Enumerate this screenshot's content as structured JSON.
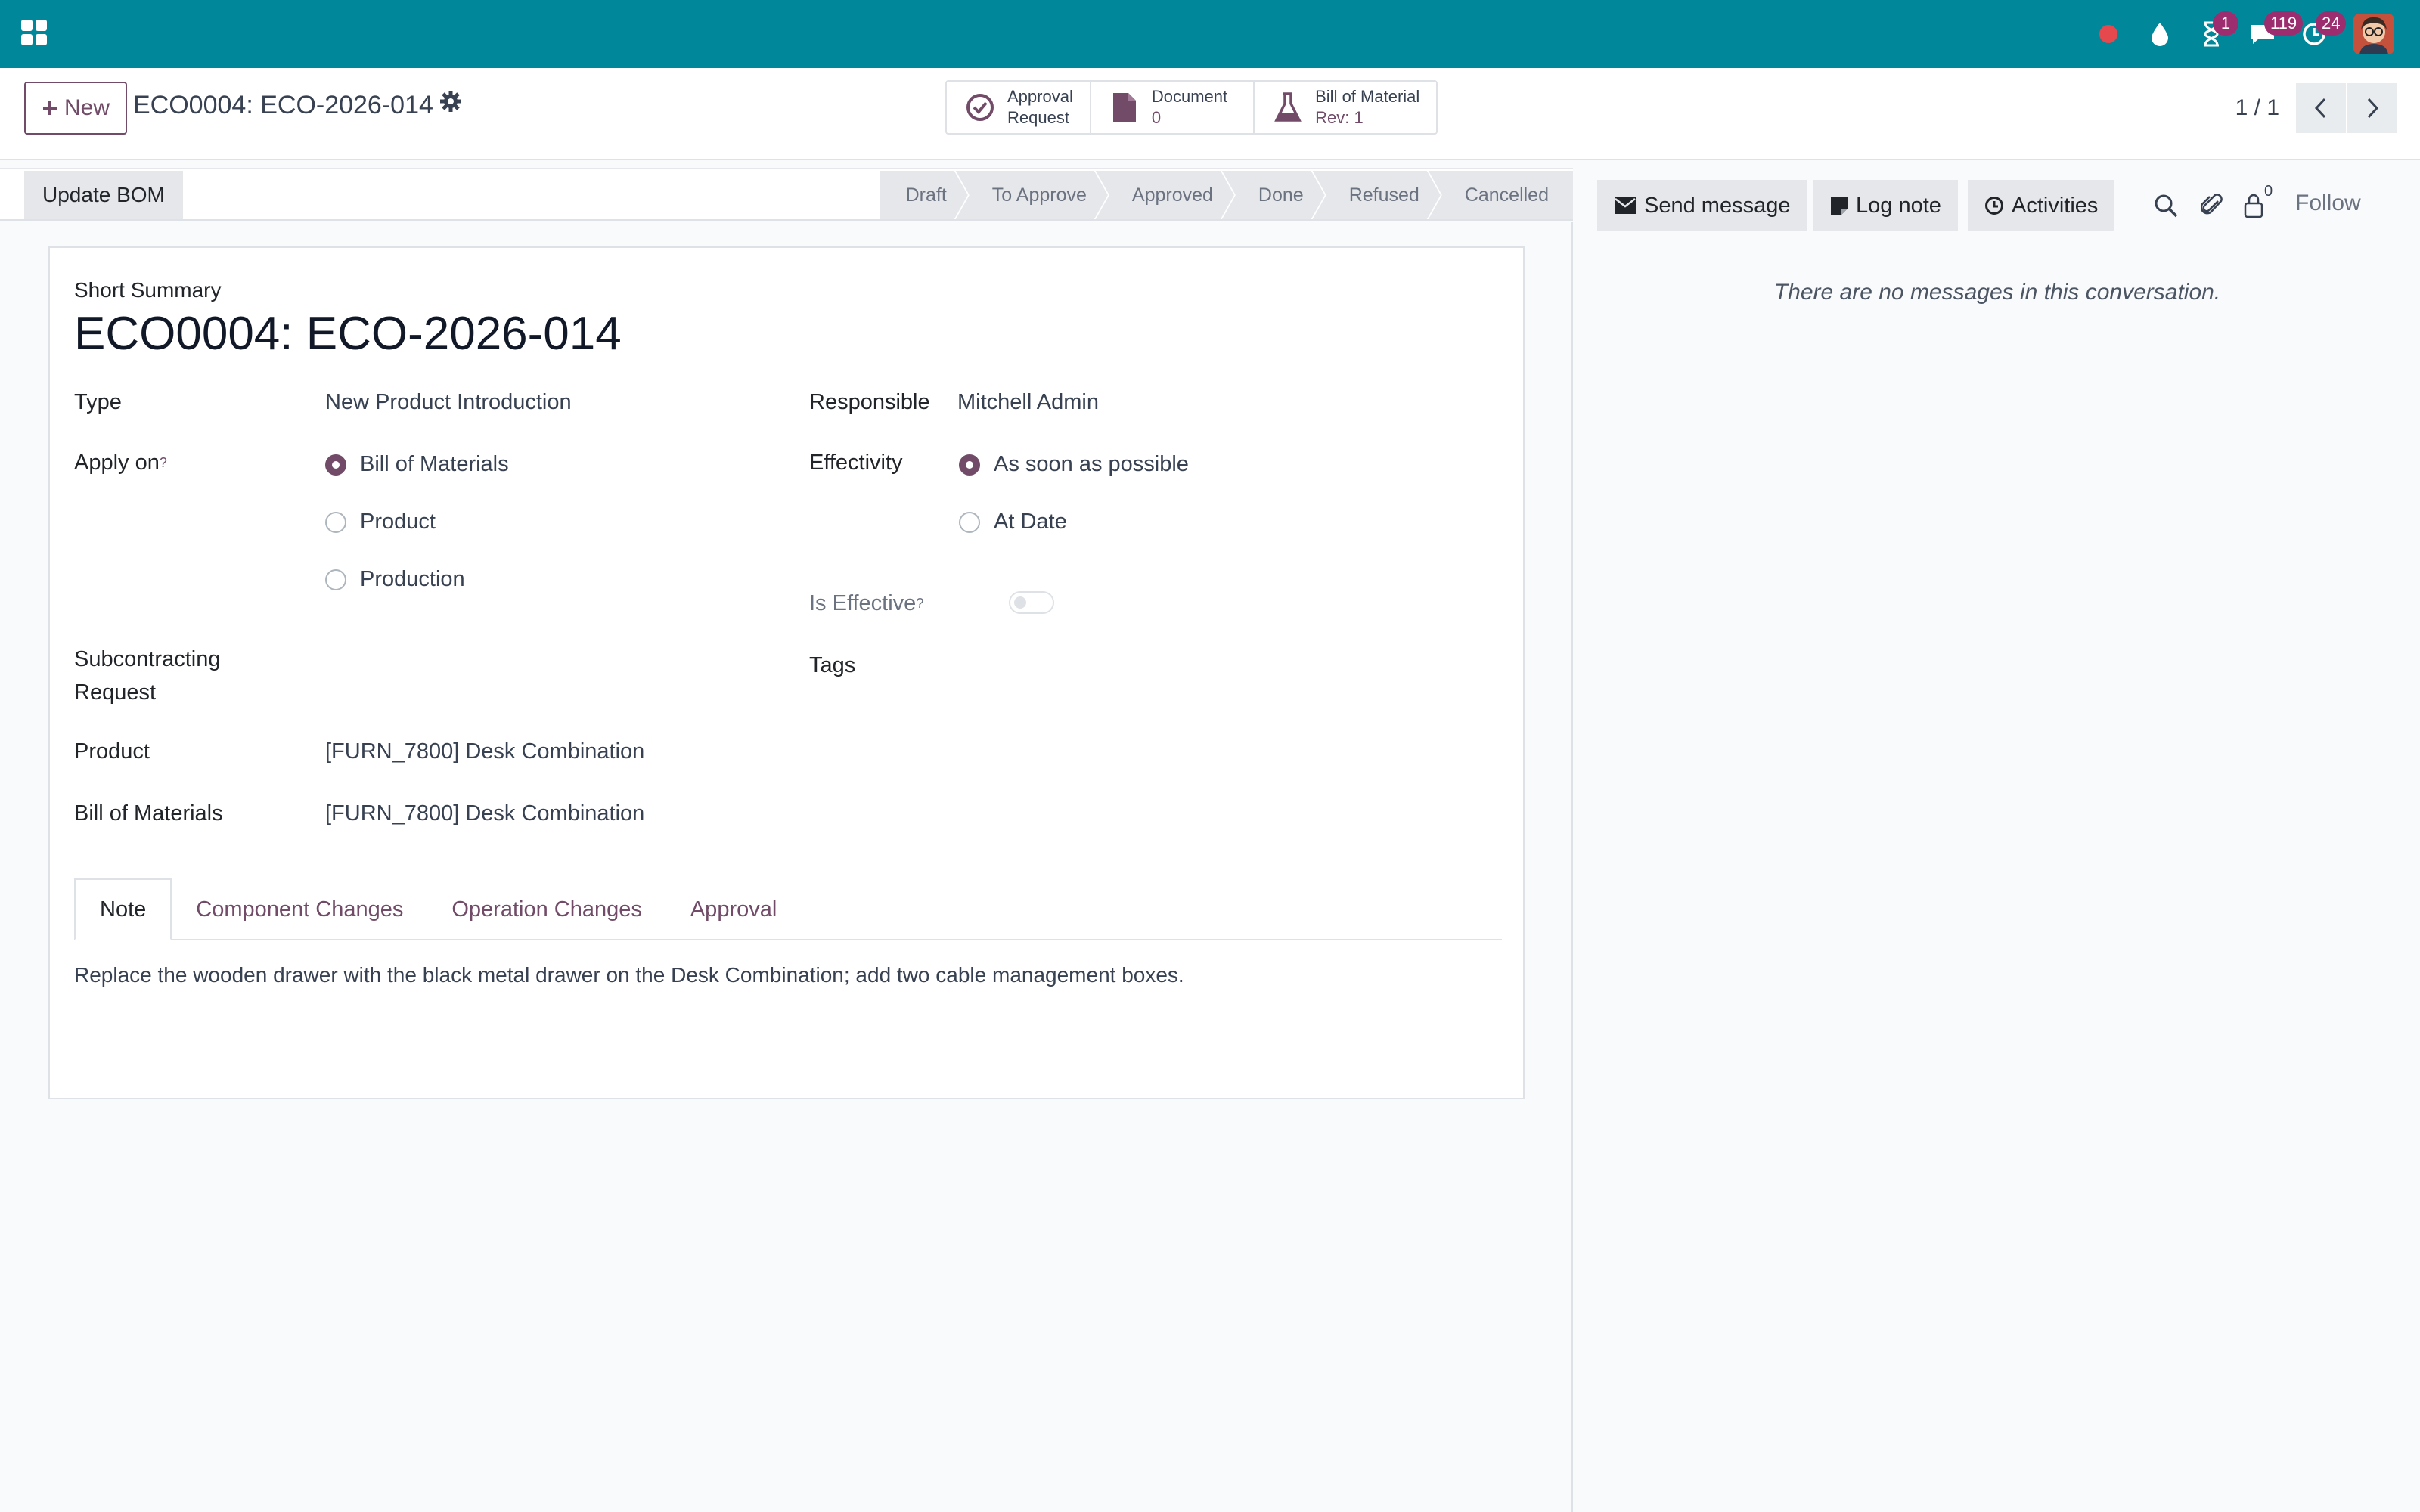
{
  "navbar": {
    "activities_badge": "1",
    "messages_badge": "119",
    "activity_clock_badge": "24",
    "colors": {
      "navbar_bg": "#00889a",
      "badge_bg": "#9c2d6f",
      "recording_dot": "#e5484d"
    },
    "icons": [
      "apps-grid-icon",
      "recording-dot-icon",
      "drop-icon",
      "hourglass-icon",
      "chat-icon",
      "clock-icon",
      "user-avatar"
    ]
  },
  "control_panel": {
    "new_label": "New",
    "record_title": "ECO0004: ECO-2026-014",
    "smart_buttons": [
      {
        "line1": "Approval",
        "line2": "Request",
        "icon": "check-circle-icon"
      },
      {
        "line1": "Document",
        "line2": "0",
        "icon": "file-icon"
      },
      {
        "line1": "Bill of Material",
        "line2": "Rev: 1",
        "icon": "flask-icon"
      }
    ],
    "pager": "1 / 1"
  },
  "statusbar": {
    "update_bom_label": "Update BOM",
    "stages": [
      "Draft",
      "To Approve",
      "Approved",
      "Done",
      "Refused",
      "Cancelled"
    ]
  },
  "form": {
    "short_summary_label": "Short Summary",
    "title": "ECO0004: ECO-2026-014",
    "type_label": "Type",
    "type_value": "New Product Introduction",
    "apply_on_label": "Apply on",
    "apply_on_help": "?",
    "apply_on_options": [
      "Bill of Materials",
      "Product",
      "Production"
    ],
    "apply_on_selected": "Bill of Materials",
    "responsible_label": "Responsible",
    "responsible_value": "Mitchell Admin",
    "effectivity_label": "Effectivity",
    "effectivity_options": [
      "As soon as possible",
      "At Date"
    ],
    "effectivity_selected": "As soon as possible",
    "is_effective_label": "Is Effective",
    "is_effective_help": "?",
    "is_effective_value": false,
    "subcontracting_label_1": "Subcontracting",
    "subcontracting_label_2": "Request",
    "tags_label": "Tags",
    "product_label": "Product",
    "product_value": "[FURN_7800] Desk Combination",
    "bom_label": "Bill of Materials",
    "bom_value": "[FURN_7800] Desk Combination",
    "tabs": [
      "Note",
      "Component Changes",
      "Operation Changes",
      "Approval"
    ],
    "active_tab": "Note",
    "note": "Replace the wooden drawer with the black metal drawer on the Desk Combination; add two cable management boxes."
  },
  "chatter": {
    "send_message_label": "Send message",
    "log_note_label": "Log note",
    "activities_label": "Activities",
    "followers_count": "0",
    "follow_label": "Follow",
    "empty_text": "There are no messages in this conversation."
  },
  "theme": {
    "primary": "#714b67",
    "stage_bg": "#e5e7eb"
  }
}
